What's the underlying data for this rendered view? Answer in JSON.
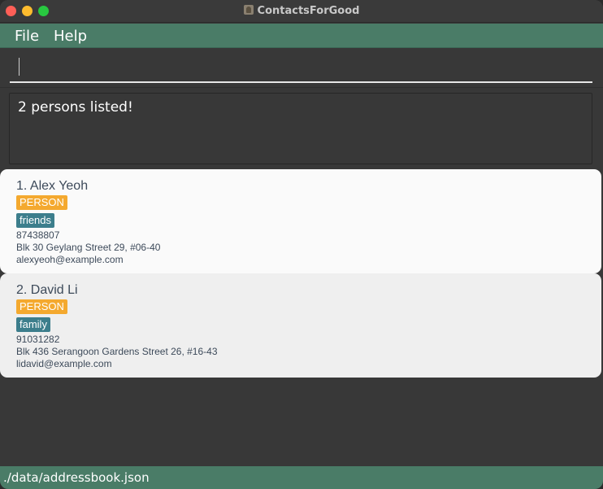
{
  "window": {
    "title": "ContactsForGood"
  },
  "menu": {
    "items": [
      {
        "label": "File"
      },
      {
        "label": "Help"
      }
    ]
  },
  "command_box": {
    "value": "",
    "placeholder": ""
  },
  "result_display": {
    "message": "2 persons listed!"
  },
  "persons": [
    {
      "index_name": "1. Alex Yeoh",
      "role_tag": "PERSON",
      "tag": "friends",
      "phone": "87438807",
      "address": "Blk 30 Geylang Street 29, #06-40",
      "email": "alexyeoh@example.com"
    },
    {
      "index_name": "2. David Li",
      "role_tag": "PERSON",
      "tag": "family",
      "phone": "91031282",
      "address": "Blk 436 Serangoon Gardens Street 26, #16-43",
      "email": "lidavid@example.com"
    }
  ],
  "status_bar": {
    "file_path": "./data/addressbook.json"
  },
  "colors": {
    "accent_green": "#4a7c67",
    "role_tag_orange": "#f4a92f",
    "group_tag_teal": "#3c7e8c",
    "background_dark": "#383838"
  }
}
